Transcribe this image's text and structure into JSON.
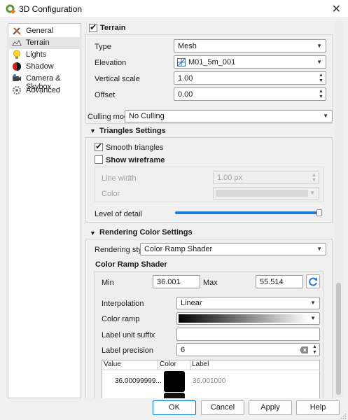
{
  "window": {
    "title": "3D Configuration",
    "close_glyph": "✕",
    "app_icon": "qgis-icon"
  },
  "sidebar": {
    "items": [
      {
        "label": "General",
        "icon": "tools-icon"
      },
      {
        "label": "Terrain",
        "icon": "terrain-icon"
      },
      {
        "label": "Lights",
        "icon": "lightbulb-icon"
      },
      {
        "label": "Shadow",
        "icon": "shadow-icon"
      },
      {
        "label": "Camera & Skybox",
        "icon": "camera-icon"
      },
      {
        "label": "Advanced",
        "icon": "advanced-icon"
      }
    ],
    "active": "Terrain"
  },
  "terrain": {
    "checkbox_label": "Terrain",
    "checked": true,
    "type_label": "Type",
    "type_value": "Mesh",
    "elevation_label": "Elevation",
    "elevation_value": "M01_5m_001",
    "vscale_label": "Vertical scale",
    "vscale_value": "1.00",
    "offset_label": "Offset",
    "offset_value": "0.00"
  },
  "culling": {
    "label": "Culling mode",
    "value": "No Culling"
  },
  "triangles": {
    "header": "Triangles Settings",
    "smooth_label": "Smooth triangles",
    "smooth_checked": true,
    "wireframe_label": "Show wireframe",
    "wireframe_checked": false,
    "line_width_label": "Line width",
    "line_width_value": "1.00 px",
    "color_label": "Color",
    "lod_label": "Level of detail",
    "lod_level": 1.0
  },
  "rendering": {
    "header": "Rendering Color Settings",
    "style_label": "Rendering style",
    "style_value": "Color Ramp Shader",
    "ramp_header": "Color Ramp Shader",
    "min_label": "Min",
    "min_value": "36.001",
    "max_label": "Max",
    "max_value": "55.514",
    "interp_label": "Interpolation",
    "interp_value": "Linear",
    "ramp_label": "Color ramp",
    "suffix_label": "Label unit suffix",
    "suffix_value": "",
    "precision_label": "Label precision",
    "precision_value": "6",
    "table": {
      "headers": [
        "Value",
        "Color",
        "Label"
      ],
      "rows": [
        {
          "value": "36.00099999...",
          "label": "36.001000",
          "color": "#000000"
        }
      ]
    }
  },
  "footer": {
    "ok": "OK",
    "cancel": "Cancel",
    "apply": "Apply",
    "help": "Help"
  },
  "colors": {
    "accent": "#0078d7",
    "slider": "#1e7ad6",
    "selected_bg": "#e4e4e4"
  }
}
